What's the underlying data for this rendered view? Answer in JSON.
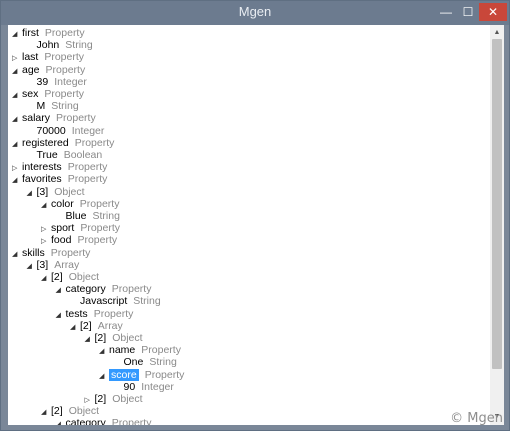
{
  "window": {
    "title": "Mgen",
    "min_glyph": "—",
    "max_glyph": "☐",
    "close_glyph": "✕"
  },
  "icons": {
    "expanded": "◢",
    "collapsed": "▷"
  },
  "watermark": "© Mgen",
  "tree": [
    {
      "level": 0,
      "state": "expanded",
      "name": "first",
      "type": "Property"
    },
    {
      "level": 1,
      "state": "leaf",
      "name": "John",
      "type": "String"
    },
    {
      "level": 0,
      "state": "collapsed",
      "name": "last",
      "type": "Property"
    },
    {
      "level": 0,
      "state": "expanded",
      "name": "age",
      "type": "Property"
    },
    {
      "level": 1,
      "state": "leaf",
      "name": "39",
      "type": "Integer"
    },
    {
      "level": 0,
      "state": "expanded",
      "name": "sex",
      "type": "Property"
    },
    {
      "level": 1,
      "state": "leaf",
      "name": "M",
      "type": "String"
    },
    {
      "level": 0,
      "state": "expanded",
      "name": "salary",
      "type": "Property"
    },
    {
      "level": 1,
      "state": "leaf",
      "name": "70000",
      "type": "Integer"
    },
    {
      "level": 0,
      "state": "expanded",
      "name": "registered",
      "type": "Property"
    },
    {
      "level": 1,
      "state": "leaf",
      "name": "True",
      "type": "Boolean"
    },
    {
      "level": 0,
      "state": "collapsed",
      "name": "interests",
      "type": "Property"
    },
    {
      "level": 0,
      "state": "expanded",
      "name": "favorites",
      "type": "Property"
    },
    {
      "level": 1,
      "state": "expanded",
      "name": "[3]",
      "type": "Object"
    },
    {
      "level": 2,
      "state": "expanded",
      "name": "color",
      "type": "Property"
    },
    {
      "level": 3,
      "state": "leaf",
      "name": "Blue",
      "type": "String"
    },
    {
      "level": 2,
      "state": "collapsed",
      "name": "sport",
      "type": "Property"
    },
    {
      "level": 2,
      "state": "collapsed",
      "name": "food",
      "type": "Property"
    },
    {
      "level": 0,
      "state": "expanded",
      "name": "skills",
      "type": "Property"
    },
    {
      "level": 1,
      "state": "expanded",
      "name": "[3]",
      "type": "Array"
    },
    {
      "level": 2,
      "state": "expanded",
      "name": "[2]",
      "type": "Object"
    },
    {
      "level": 3,
      "state": "expanded",
      "name": "category",
      "type": "Property"
    },
    {
      "level": 4,
      "state": "leaf",
      "name": "Javascript",
      "type": "String"
    },
    {
      "level": 3,
      "state": "expanded",
      "name": "tests",
      "type": "Property"
    },
    {
      "level": 4,
      "state": "expanded",
      "name": "[2]",
      "type": "Array"
    },
    {
      "level": 5,
      "state": "expanded",
      "name": "[2]",
      "type": "Object"
    },
    {
      "level": 6,
      "state": "expanded",
      "name": "name",
      "type": "Property"
    },
    {
      "level": 7,
      "state": "leaf",
      "name": "One",
      "type": "String"
    },
    {
      "level": 6,
      "state": "expanded",
      "name": "score",
      "type": "Property",
      "selected": true
    },
    {
      "level": 7,
      "state": "leaf",
      "name": "90",
      "type": "Integer"
    },
    {
      "level": 5,
      "state": "collapsed",
      "name": "[2]",
      "type": "Object"
    },
    {
      "level": 2,
      "state": "expanded",
      "name": "[2]",
      "type": "Object"
    },
    {
      "level": 3,
      "state": "expanded",
      "name": "category",
      "type": "Property"
    }
  ]
}
